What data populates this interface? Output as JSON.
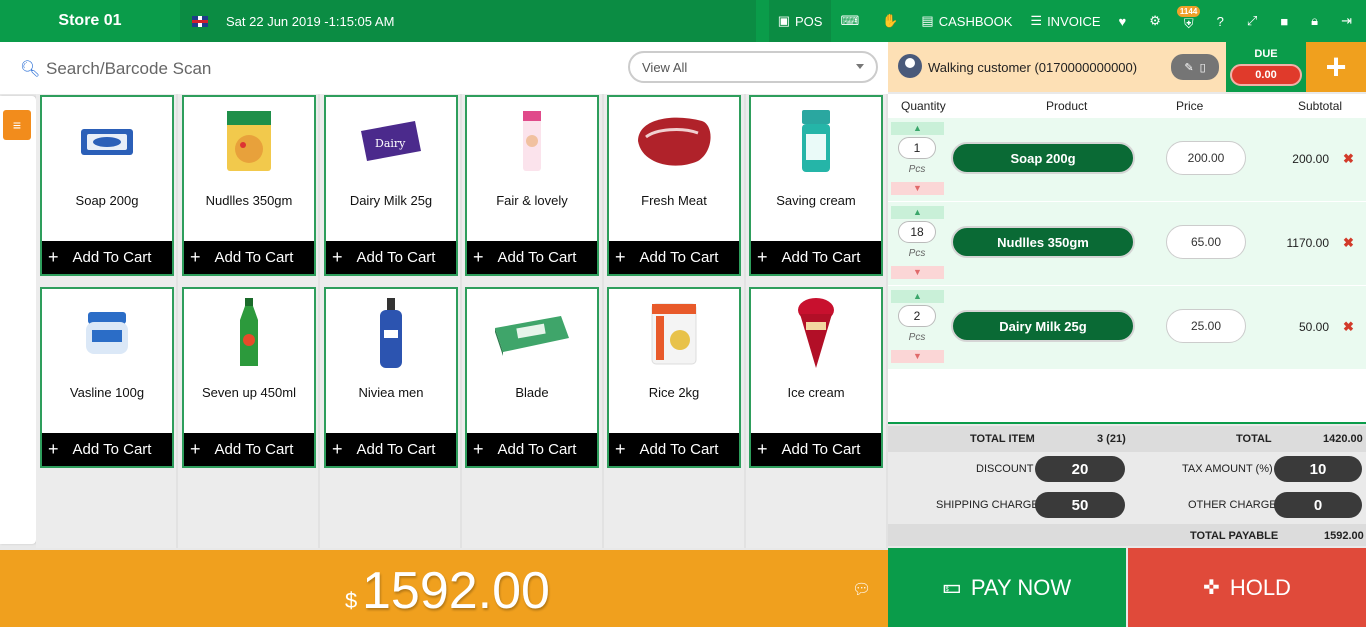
{
  "header": {
    "store": "Store 01",
    "datetime": "Sat 22 Jun 2019 -1:15:05 AM",
    "nav": {
      "pos": "POS",
      "cashbook": "CASHBOOK",
      "invoice": "INVOICE",
      "badge": "1144"
    }
  },
  "search": {
    "placeholder": "Search/Barcode Scan",
    "filter": "View All"
  },
  "products": [
    {
      "name": "Soap 200g",
      "btn": "Add To Cart"
    },
    {
      "name": "Nudlles 350gm",
      "btn": "Add To Cart"
    },
    {
      "name": "Dairy Milk 25g",
      "btn": "Add To Cart"
    },
    {
      "name": "Fair & lovely",
      "btn": "Add To Cart"
    },
    {
      "name": "Fresh Meat",
      "btn": "Add To Cart"
    },
    {
      "name": "Saving cream",
      "btn": "Add To Cart"
    },
    {
      "name": "Vasline 100g",
      "btn": "Add To Cart"
    },
    {
      "name": "Seven up 450ml",
      "btn": "Add To Cart"
    },
    {
      "name": "Niviea men",
      "btn": "Add To Cart"
    },
    {
      "name": "Blade",
      "btn": "Add To Cart"
    },
    {
      "name": "Rice 2kg",
      "btn": "Add To Cart"
    },
    {
      "name": "Ice cream",
      "btn": "Add To Cart"
    }
  ],
  "total_bar": {
    "currency": "$",
    "amount": "1592.00"
  },
  "customer": {
    "name": "Walking customer (0170000000000)",
    "due_label": "DUE",
    "due_value": "0.00"
  },
  "cart": {
    "columns": {
      "qty": "Quantity",
      "product": "Product",
      "price": "Price",
      "subtotal": "Subtotal"
    },
    "rows": [
      {
        "qty": "1",
        "unit": "Pcs",
        "product": "Soap 200g",
        "price": "200.00",
        "subtotal": "200.00"
      },
      {
        "qty": "18",
        "unit": "Pcs",
        "product": "Nudlles 350gm",
        "price": "65.00",
        "subtotal": "1170.00"
      },
      {
        "qty": "2",
        "unit": "Pcs",
        "product": "Dairy Milk 25g",
        "price": "25.00",
        "subtotal": "50.00"
      }
    ]
  },
  "summary": {
    "total_item_label": "TOTAL ITEM",
    "total_item": "3 (21)",
    "total_label": "TOTAL",
    "total": "1420.00",
    "discount_label": "DISCOUNT",
    "discount": "20",
    "tax_label": "TAX AMOUNT (%)",
    "tax": "10",
    "shipping_label": "SHIPPING CHARGE",
    "shipping": "50",
    "other_label": "OTHER CHARGE",
    "other": "0",
    "payable_label": "TOTAL PAYABLE",
    "payable": "1592.00"
  },
  "actions": {
    "pay": "PAY NOW",
    "hold": "HOLD"
  },
  "colors": {
    "primary": "#0a9c4a",
    "accent": "#f0a01e",
    "danger": "#e04a3a"
  }
}
